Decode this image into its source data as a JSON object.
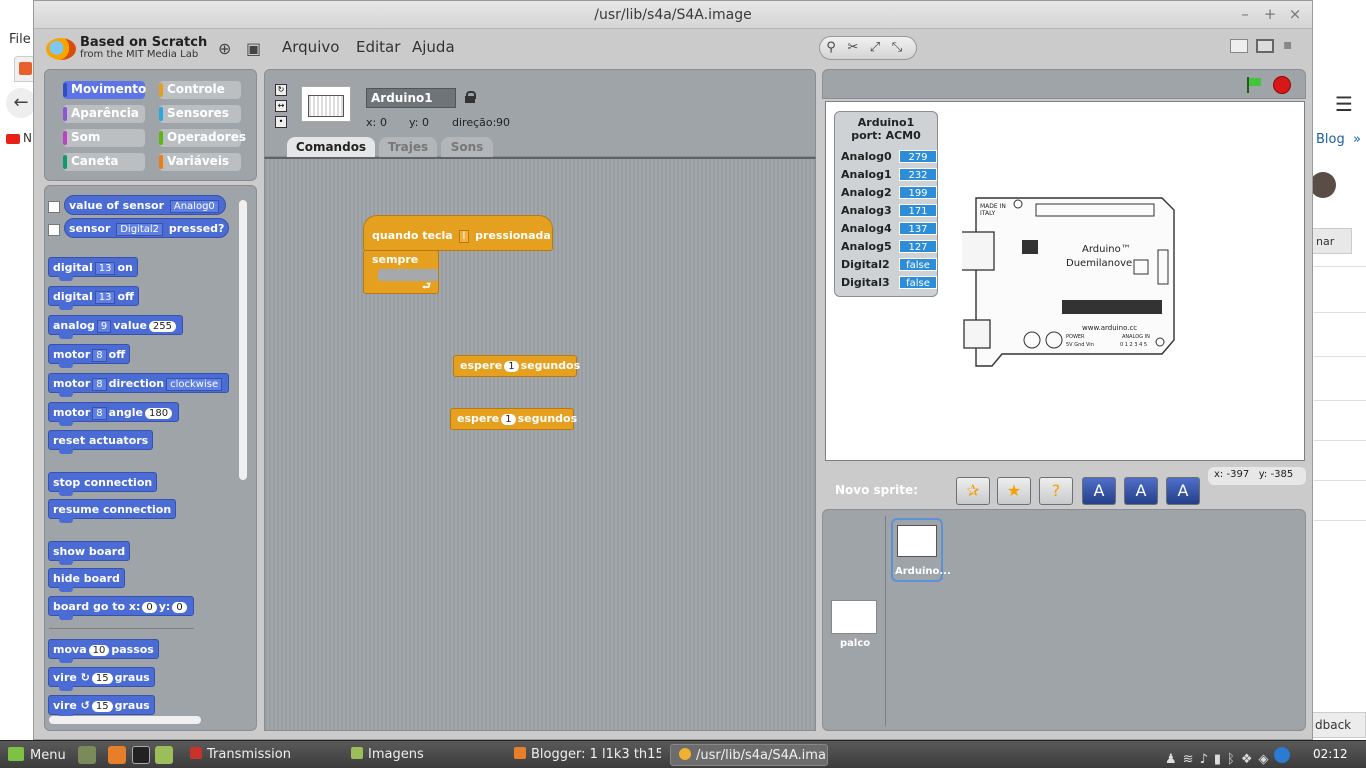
{
  "background_browser": {
    "file_menu": "File",
    "bookmark_blog": "Blog",
    "bookmark_more": "»",
    "partial_button": "nar",
    "feedback": "dback"
  },
  "window": {
    "title": "/usr/lib/s4a/S4A.image",
    "btn_minimize": "–",
    "btn_maximize": "+",
    "btn_close": "×"
  },
  "menubar": {
    "logo_title": "Based on Scratch",
    "logo_subtitle": "from the MIT Media Lab",
    "menus": [
      "Arquivo",
      "Editar",
      "Ajuda"
    ],
    "tools": [
      "⚲",
      "✂",
      "⤢",
      "⤡"
    ]
  },
  "categories": [
    {
      "label": "Movimento",
      "color": "#4a6cd4",
      "selected": true
    },
    {
      "label": "Controle",
      "color": "#e6a020"
    },
    {
      "label": "Aparência",
      "color": "#8a55d7"
    },
    {
      "label": "Sensores",
      "color": "#2ca5e2"
    },
    {
      "label": "Som",
      "color": "#bb42c3"
    },
    {
      "label": "Operadores",
      "color": "#5cb712"
    },
    {
      "label": "Caneta",
      "color": "#0e9a6c"
    },
    {
      "label": "Variáveis",
      "color": "#ee7d16"
    }
  ],
  "palette": {
    "b1_text": "value of sensor",
    "b1_dd": "Analog0",
    "b2_pre": "sensor",
    "b2_dd": "Digital2",
    "b2_post": "pressed?",
    "b3_pre": "digital",
    "b3_dd": "13",
    "b3_post": "on",
    "b4_pre": "digital",
    "b4_dd": "13",
    "b4_post": "off",
    "b5_pre": "analog",
    "b5_dd": "9",
    "b5_mid": "value",
    "b5_val": "255",
    "b6_pre": "motor",
    "b6_dd": "8",
    "b6_post": "off",
    "b7_pre": "motor",
    "b7_dd": "8",
    "b7_mid": "direction",
    "b7_dd2": "clockwise",
    "b8_pre": "motor",
    "b8_dd": "8",
    "b8_mid": "angle",
    "b8_val": "180",
    "b9": "reset actuators",
    "b10": "stop connection",
    "b11": "resume connection",
    "b12": "show board",
    "b13": "hide board",
    "b14_pre": "board go to x:",
    "b14_x": "0",
    "b14_mid": "y:",
    "b14_y": "0",
    "b15_pre": "mova",
    "b15_val": "10",
    "b15_post": "passos",
    "b16_pre": "vire ↻",
    "b16_val": "15",
    "b16_post": "graus",
    "b17_pre": "vire ↺",
    "b17_val": "15",
    "b17_post": "graus"
  },
  "sprite": {
    "name": "Arduino1",
    "x_label": "x:",
    "x": "0",
    "y_label": "y:",
    "y": "0",
    "dir_label": "direção:",
    "dir": "90"
  },
  "tabs": [
    "Comandos",
    "Trajes",
    "Sons"
  ],
  "scripts": {
    "hat_pre": "quando tecla",
    "hat_dd": "l",
    "hat_post": "pressionada",
    "forever": "sempre",
    "wait1_pre": "espere",
    "wait1_val": "1",
    "wait1_post": "segundos",
    "wait2_pre": "espere",
    "wait2_val": "1",
    "wait2_post": "segundos"
  },
  "sensor_board": {
    "title": "Arduino1",
    "port": "port: ACM0",
    "rows": [
      {
        "name": "Analog0",
        "value": "279"
      },
      {
        "name": "Analog1",
        "value": "232"
      },
      {
        "name": "Analog2",
        "value": "199"
      },
      {
        "name": "Analog3",
        "value": "171"
      },
      {
        "name": "Analog4",
        "value": "137"
      },
      {
        "name": "Analog5",
        "value": "127"
      },
      {
        "name": "Digital2",
        "value": "false"
      },
      {
        "name": "Digital3",
        "value": "false"
      }
    ]
  },
  "board_image": {
    "made_in": "MADE IN",
    "italy": "ITALY",
    "arduino": "Arduino™",
    "model": "Duemilanove",
    "site": "www.arduino.cc",
    "power": "POWER",
    "analog_in": "ANALOG IN",
    "voltage": "5V Gnd Vin",
    "pins": "0 1 2 3 4 5"
  },
  "stage": {
    "mouse_x_label": "x:",
    "mouse_x": "-397",
    "mouse_y_label": "y:",
    "mouse_y": "-385"
  },
  "new_sprite": {
    "label": "Novo sprite:"
  },
  "sprites": {
    "card_label": "Arduino...",
    "stage_label": "palco"
  },
  "taskbar": {
    "menu": "Menu",
    "tasks": [
      "Transmission",
      "Imagens",
      "Blogger: 1 l1k3 th15 ...",
      "/usr/lib/s4a/S4A.ima..."
    ],
    "clock": "02:12"
  }
}
